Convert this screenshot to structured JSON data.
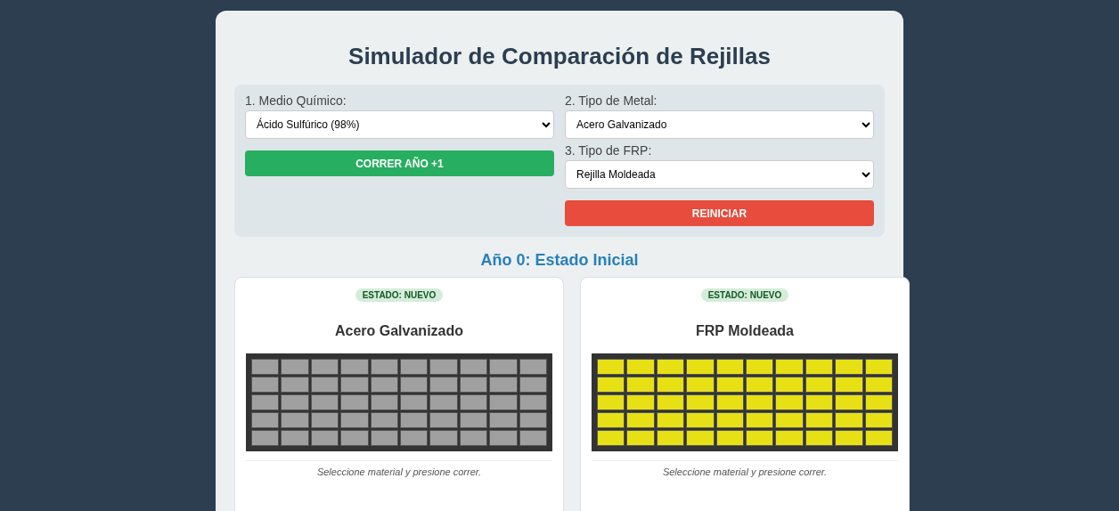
{
  "title": "Simulador de Comparación de Rejillas",
  "controls": {
    "left": [
      {
        "kind": "select",
        "label": "1. Medio Químico:",
        "value": "Ácido Sulfúrico (98%)"
      },
      {
        "kind": "button",
        "label": "CORRER AÑO +1",
        "color": "#27ae60"
      }
    ],
    "right": [
      {
        "kind": "select",
        "label": "2. Tipo de Metal:",
        "value": "Acero Galvanizado"
      },
      {
        "kind": "select",
        "label": "3. Tipo de FRP:",
        "value": "Rejilla Moldeada"
      },
      {
        "kind": "button",
        "label": "REINICIAR",
        "color": "#e74c3c"
      }
    ]
  },
  "year_heading": "Año 0: Estado Inicial",
  "panels": [
    {
      "badge": "ESTADO: NUEVO",
      "name": "Acero Galvanizado",
      "color": "#a0a0a0",
      "note": "Seleccione material y presione correr."
    },
    {
      "badge": "ESTADO: NUEVO",
      "name": "FRP Moldeada",
      "color": "#e6e015",
      "note": "Seleccione material y presione correr."
    }
  ]
}
